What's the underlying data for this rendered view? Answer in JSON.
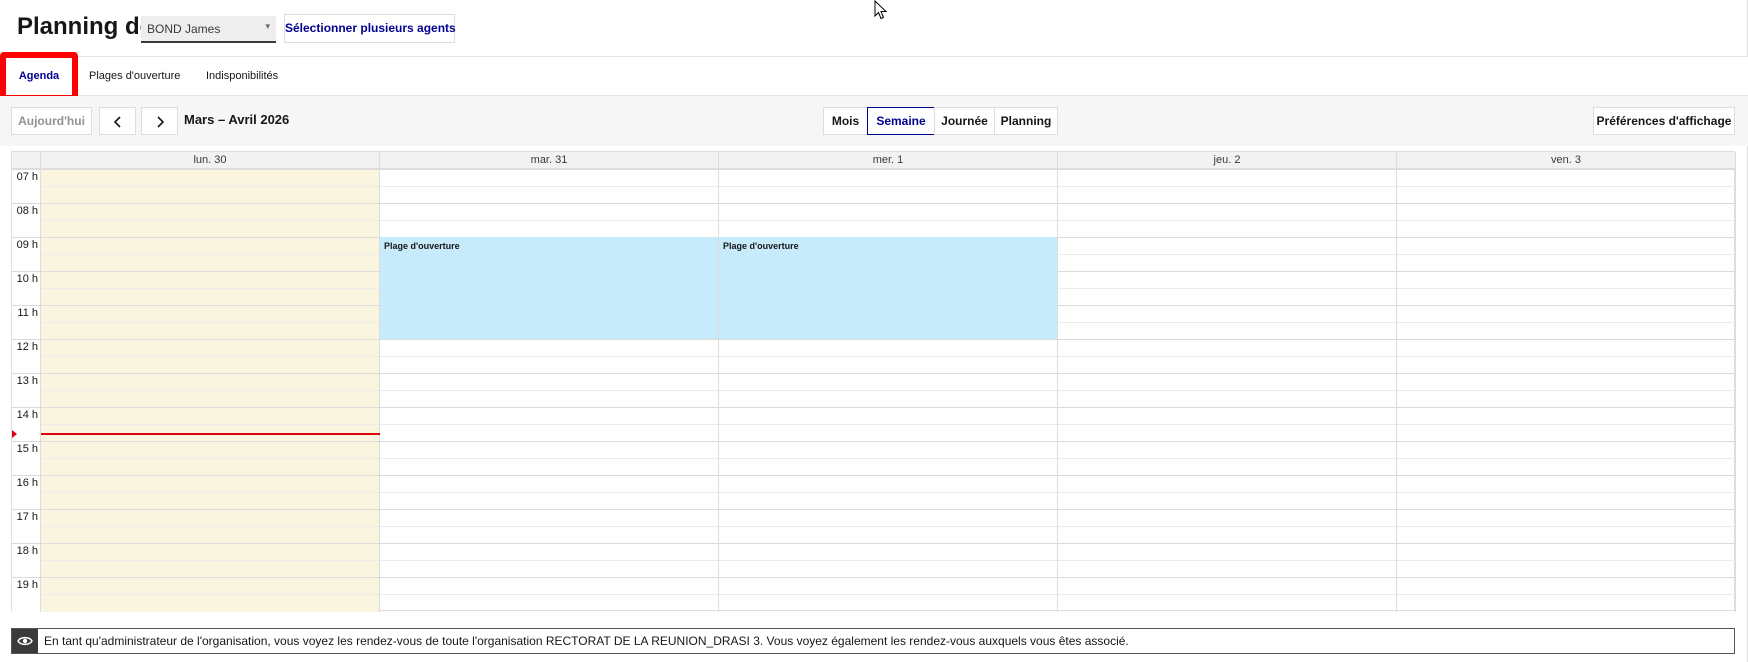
{
  "header": {
    "title": "Planning de",
    "agent_select_value": "BOND James",
    "multi_agents_label": "Sélectionner plusieurs agents"
  },
  "tabs": [
    {
      "label": "Agenda",
      "active": true
    },
    {
      "label": "Plages d'ouverture",
      "active": false
    },
    {
      "label": "Indisponibilités",
      "active": false
    }
  ],
  "toolbar": {
    "today_label": "Aujourd'hui",
    "prev_icon": "chevron-left-icon",
    "next_icon": "chevron-right-icon",
    "range_title": "Mars – Avril 2026",
    "views": [
      {
        "label": "Mois",
        "active": false
      },
      {
        "label": "Semaine",
        "active": true
      },
      {
        "label": "Journée",
        "active": false
      },
      {
        "label": "Planning",
        "active": false
      }
    ],
    "preferences_label": "Préférences d'affichage"
  },
  "calendar": {
    "days": [
      {
        "label": "lun. 30",
        "today": true
      },
      {
        "label": "mar. 31",
        "today": false
      },
      {
        "label": "mer. 1",
        "today": false
      },
      {
        "label": "jeu. 2",
        "today": false
      },
      {
        "label": "ven. 3",
        "today": false
      }
    ],
    "hours": [
      "07 h",
      "08 h",
      "09 h",
      "10 h",
      "11 h",
      "12 h",
      "13 h",
      "14 h",
      "15 h",
      "16 h",
      "17 h",
      "18 h",
      "19 h"
    ],
    "events": [
      {
        "day": 1,
        "start": "09:00",
        "end": "12:00",
        "title": "Plage d'ouverture"
      },
      {
        "day": 2,
        "start": "09:00",
        "end": "12:00",
        "title": "Plage d'ouverture"
      }
    ],
    "now_time": "14:45"
  },
  "info_bar": {
    "icon": "eye-icon",
    "text": "En tant qu'administrateur de l'organisation, vous voyez les rendez-vous de toute l'organisation RECTORAT DE LA REUNION_DRASI 3. Vous voyez également les rendez-vous auxquels vous êtes associé."
  },
  "colors": {
    "primary": "#000091",
    "today_bg": "#f9f5df",
    "event_bg": "#c8ebfb",
    "now_line": "#e1000f",
    "highlight": "#ff0000"
  }
}
